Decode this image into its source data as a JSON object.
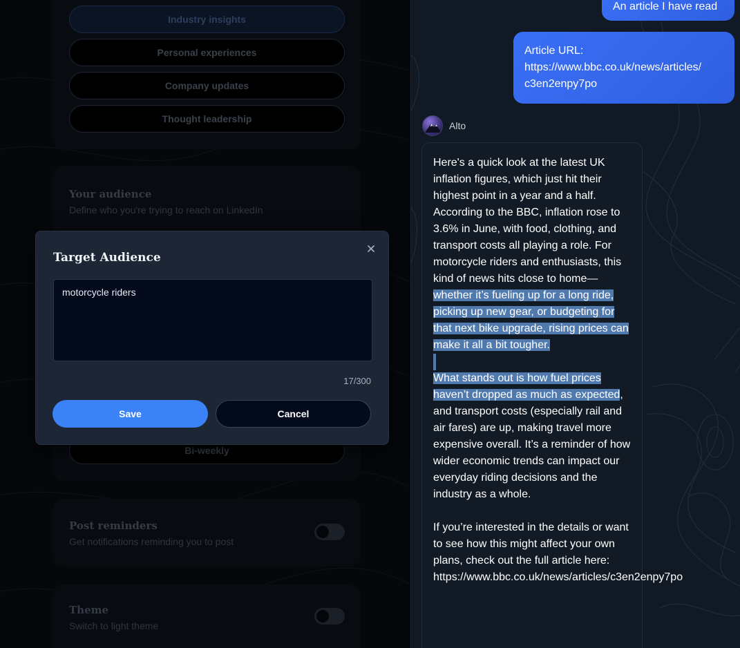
{
  "settings": {
    "topics": {
      "options": [
        "Industry insights",
        "Personal experiences",
        "Company updates",
        "Thought leadership"
      ],
      "selected": "Industry insights"
    },
    "audience": {
      "title": "Your audience",
      "subtitle": "Define who you're trying to reach on LinkedIn"
    },
    "frequency": {
      "visible_option": "Bi-weekly"
    },
    "reminders": {
      "title": "Post reminders",
      "subtitle": "Get notifications reminding you to post",
      "enabled": false
    },
    "theme": {
      "title": "Theme",
      "subtitle": "Switch to light theme",
      "enabled": false
    }
  },
  "modal": {
    "title": "Target Audience",
    "value": "motorcycle riders",
    "counter": "17/300",
    "save_label": "Save",
    "cancel_label": "Cancel",
    "close_icon": "close-icon"
  },
  "chat": {
    "user_messages": [
      "An article I have read",
      "Article URL: https://www.bbc.co.uk/news/articles/c3en2enpy7po"
    ],
    "user_url_label": "Article URL:",
    "user_url_line1": "https://www.bbc.co.uk/news/articles/",
    "user_url_line2": "c3en2enpy7po",
    "assistant_name": "Alto",
    "assistant_avatar_icon": "mountain-avatar-icon",
    "reply": {
      "p1_plain": "Here's a quick look at the latest UK inflation figures, which just hit their highest point in a year and a half. According to the BBC, inflation rose to 3.6% in June, with food, clothing, and transport costs all playing a role. For motorcycle riders and enthusiasts, this kind of news hits close to home—",
      "p1_highlight": "whether it’s fueling up for a long ride, picking up new gear, or budgeting for that next bike upgrade, rising prices can make it all a bit tougher.",
      "p2_highlight": "What stands out is how fuel prices haven’t dropped as much as expected",
      "p2_plain": ", and transport costs (especially rail and air fares) are up, making travel more expensive overall. It’s a reminder of how wider economic trends can impact our everyday riding decisions and the industry as a whole.",
      "p3": "If you’re interested in the details or want to see how this might affect your own plans, check out the full article here: https://www.bbc.co.uk/news/articles/c3en2enpy7po"
    }
  },
  "colors": {
    "accent": "#3b82f6",
    "user_bubble": "#3a6ff5",
    "highlight": "#5079ae",
    "modal_bg": "#1d2634"
  }
}
